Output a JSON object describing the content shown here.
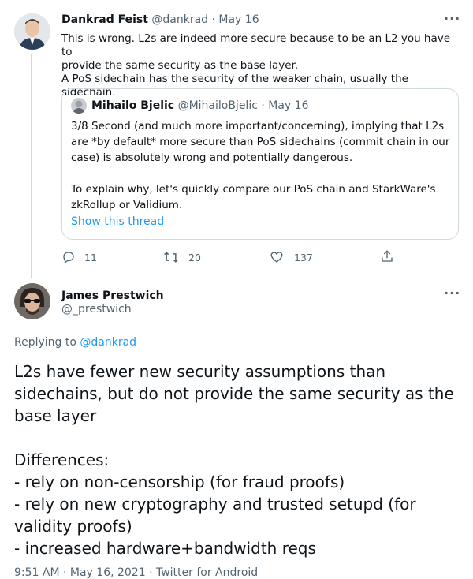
{
  "tweet1": {
    "name": "Dankrad Feist",
    "handle": "@dankrad",
    "date": "· May 16",
    "text": "This is wrong. L2s are indeed more secure because to be an L2 you have to\nprovide the same security as the base layer.\nA PoS sidechain has the security of the weaker chain, usually the sidechain.",
    "quote": {
      "name": "Mihailo Bjelic",
      "handle": "@MihailoBjelic",
      "date": "· May 16",
      "text": "3/8 Second (and much more important/concerning), implying that L2s\nare *by default* more secure than PoS sidechains (commit chain in our\ncase) is absolutely wrong and potentially dangerous.\n\nTo explain why, let's quickly compare our PoS chain and StarkWare's\nzkRollup or Validium.",
      "show_thread": "Show this thread"
    },
    "actions": {
      "replies": "11",
      "retweets": "20",
      "likes": "137"
    }
  },
  "tweet2": {
    "name": "James Prestwich",
    "handle": "@_prestwich",
    "replying_prefix": "Replying to ",
    "replying_to": "@dankrad",
    "text": "L2s have fewer new security assumptions than\nsidechains, but do not provide the same security as the\nbase layer\n\n Differences:\n- rely on non-censorship (for fraud proofs)\n- rely on new cryptography and trusted setupd (for\nvalidity proofs)\n- increased hardware+bandwidth reqs",
    "footer": "9:51 AM · May 16, 2021 · Twitter for Android"
  },
  "colors": {
    "accent": "#1d9bf0",
    "muted": "#536471",
    "border": "#cfd9de"
  }
}
